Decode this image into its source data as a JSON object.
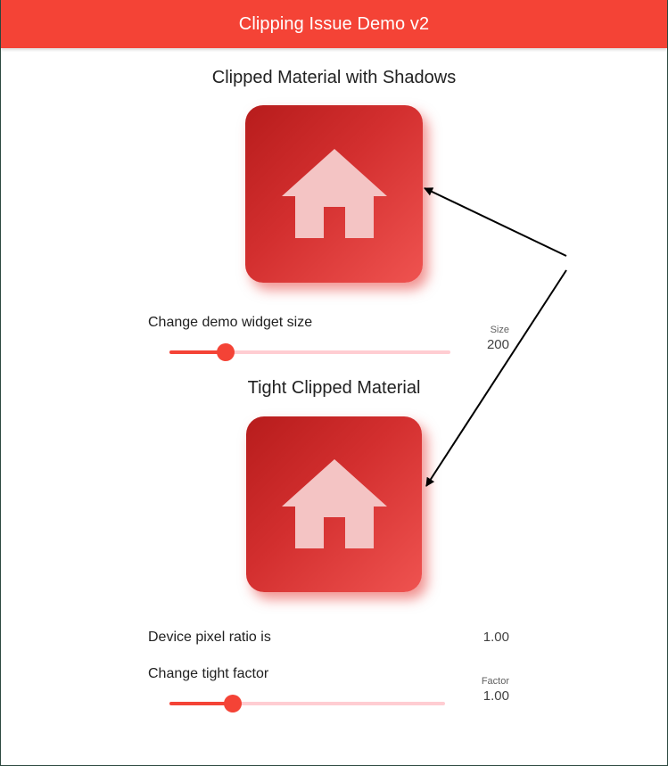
{
  "appbar": {
    "title": "Clipping Issue Demo v2"
  },
  "section1": {
    "title": "Clipped Material with Shadows",
    "icon": "home-icon"
  },
  "size_control": {
    "label": "Change demo widget size",
    "caption": "Size",
    "value": "200",
    "slider_fraction": 0.2
  },
  "section2": {
    "title": "Tight Clipped Material",
    "icon": "home-icon"
  },
  "dpr": {
    "label": "Device pixel ratio is",
    "value": "1.00"
  },
  "factor_control": {
    "label": "Change tight factor",
    "caption": "Factor",
    "value": "1.00",
    "slider_fraction": 0.23
  },
  "colors": {
    "accent": "#f44336",
    "track_inactive": "#ffcdd2",
    "box_dark": "#b71c1c",
    "box_light": "#ef5350",
    "icon": "#f4c4c4",
    "arrow": "#000000"
  }
}
